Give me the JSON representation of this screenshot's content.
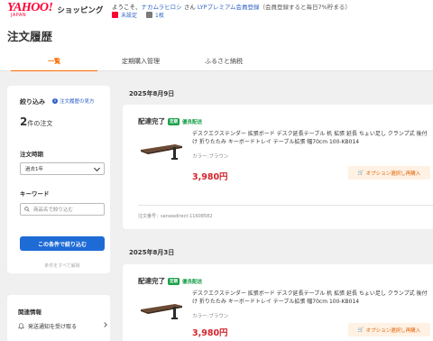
{
  "header": {
    "logo_main": "YAHOO!",
    "logo_sub": "JAPAN",
    "logo_shopping": "ショッピング",
    "welcome_prefix": "ようこそ、",
    "user_name": "ナカムラヒロシ",
    "honorific": " さん ",
    "lyp_link": "LYPプレミアム会員登録",
    "lyp_note": "（会員登録すると毎日7%貯まる）",
    "setting_label": "未設定",
    "coupon_label": "1枚",
    "setting_icon_color": "#ff0033",
    "coupon_icon_color": "#7a7a7a"
  },
  "page_title": "注文履歴",
  "tabs": [
    {
      "label": "一覧",
      "active": true
    },
    {
      "label": "定期購入管理",
      "active": false
    },
    {
      "label": "ふるさと納税",
      "active": false
    }
  ],
  "sidebar": {
    "title": "絞り込み",
    "help_link": "注文履歴の見方",
    "count_number": "2",
    "count_suffix": "件の注文",
    "period_label": "注文時期",
    "period_value": "過去1年",
    "keyword_label": "キーワード",
    "keyword_placeholder": "商品名で絞り込む",
    "search_button": "この条件で絞り込む",
    "reset_label": "条件をすべて解除"
  },
  "related": {
    "title": "関連情報",
    "item": "発送通知を受け取る"
  },
  "orders": [
    {
      "date": "2025年8月9日",
      "status": "配達完了",
      "badge": "定期",
      "badge_text": "優良配送",
      "product_name": "デスクエクステンダー 拡張ボード デスク延長テーブル 机 拡張 延長 ちょい足し クランプ式 後付け 折りたたみ キーボードトレイ テーブル拡張 幅70cm 100-KB014",
      "color": "カラー:ブラウン",
      "price": "3,980円",
      "option_button": "オプション選択し再購入",
      "order_number": "注文番号：sanwadirect-11608582"
    },
    {
      "date": "2025年8月3日",
      "status": "配達完了",
      "badge": "定期",
      "badge_text": "優良配送",
      "product_name": "デスクエクステンダー 拡張ボード デスク延長テーブル 机 拡張 延長 ちょい足し クランプ式 後付け 折りたたみ キーボードトレイ テーブル拡張 幅70cm 100-KB014",
      "color": "カラー:ブラウン",
      "price": "3,980円",
      "option_button": "オプション選択し再購入"
    }
  ],
  "colors": {
    "accent_orange": "#ff6c00",
    "price_red": "#d3242b",
    "button_blue": "#1e6bd6",
    "link_blue": "#2a5fc4",
    "badge_green": "#1aa04a"
  }
}
